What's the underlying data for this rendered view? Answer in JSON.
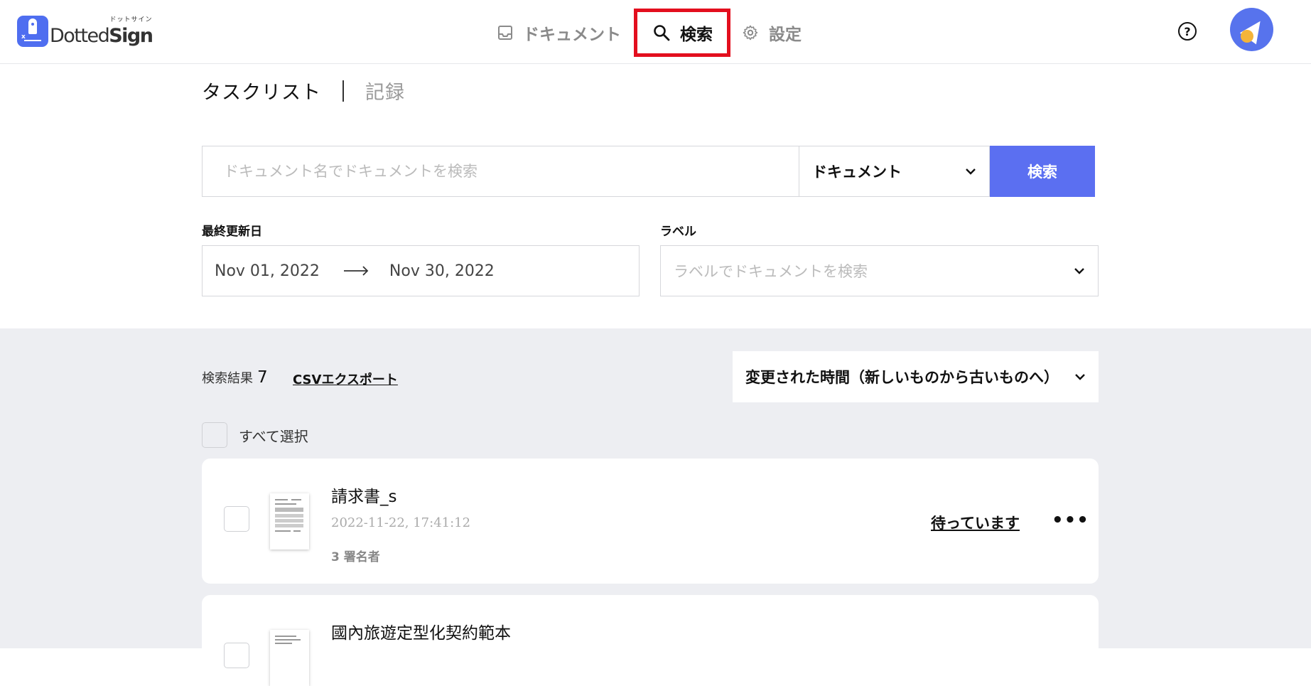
{
  "header": {
    "logo": {
      "ruby": "ドットサイン",
      "name_light": "Dotted",
      "name_bold": "Sign"
    },
    "nav": [
      {
        "label": "ドキュメント",
        "icon": "inbox-icon",
        "active": false
      },
      {
        "label": "検索",
        "icon": "search-icon",
        "active": true
      },
      {
        "label": "設定",
        "icon": "gear-icon",
        "active": false
      }
    ],
    "help_symbol": "?",
    "highlight_color": "#e30f1e"
  },
  "page_tabs": {
    "active": "タスクリスト",
    "inactive": "記録"
  },
  "search": {
    "placeholder": "ドキュメント名でドキュメントを検索",
    "type_selected": "ドキュメント",
    "button_label": "検索",
    "accent_color": "#5b6ff1"
  },
  "filters": {
    "date_label": "最終更新日",
    "date_from": "Nov 01, 2022",
    "date_to": "Nov 30, 2022",
    "label_label": "ラベル",
    "label_placeholder": "ラベルでドキュメントを検索"
  },
  "results": {
    "count_label": "検索結果",
    "count": "7",
    "csv_export": "CSVエクスポート",
    "sort_selected": "変更された時間（新しいものから古いものへ）",
    "select_all": "すべて選択",
    "items": [
      {
        "title": "請求書_s",
        "date": "2022-11-22, 17:41:12",
        "signers": "3 署名者",
        "status": "待っています",
        "more": "•••"
      },
      {
        "title": "國內旅遊定型化契約範本"
      }
    ]
  }
}
